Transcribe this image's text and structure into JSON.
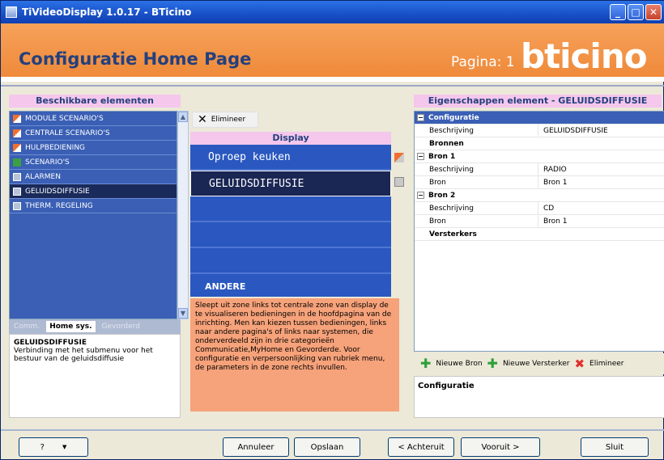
{
  "window": {
    "title": "TiVideoDisplay 1.0.17 - BTicino"
  },
  "header": {
    "title": "Configuratie Home Page",
    "pagina": "Pagina: 1",
    "logo": "bticino"
  },
  "left": {
    "heading": "Beschikbare elementen",
    "items": [
      {
        "label": "MODULE SCENARIO'S",
        "icon": "flag-icon"
      },
      {
        "label": "CENTRALE SCENARIO'S",
        "icon": "flag-icon"
      },
      {
        "label": "HULPBEDIENING",
        "icon": "flag-icon"
      },
      {
        "label": "SCENARIO'S",
        "icon": "green-icon"
      },
      {
        "label": "ALARMEN",
        "icon": "gray-icon"
      },
      {
        "label": "GELUIDSDIFFUSIE",
        "icon": "gray-icon"
      },
      {
        "label": "THERM. REGELING",
        "icon": "gray-icon"
      }
    ],
    "tabs": [
      "Comm.",
      "Home sys.",
      "Gevorderd"
    ],
    "desc_title": "GELUIDSDIFFUSIE",
    "desc_text": "Verbinding met het submenu voor het bestuur van de geluidsdiffusie"
  },
  "center": {
    "elimineer": "Elimineer",
    "display_heading": "Display",
    "rows": [
      "Oproep keuken",
      "GELUIDSDIFFUSIE",
      "",
      "",
      "",
      "ANDERE"
    ],
    "info": "Sleept uit zone links tot centrale zone van display de te visualiseren bedieningen in de hoofdpagina van de inrichting. Men kan kiezen tussen bedieningen, links naar andere pagina's of links naar systemen, die onderverdeeld zijn in drie categorieën Communicatie,MyHome en Gevorderde. Voor configuratie en verpersoonlijking van rubriek menu, de parameters in de zone rechts invullen."
  },
  "right": {
    "heading": "Eigenschappen element - GELUIDSDIFFUSIE",
    "props": [
      {
        "type": "group",
        "label": "Configuratie"
      },
      {
        "type": "row",
        "k": "Beschrijving",
        "v": "GELUIDSDIFFUSIE"
      },
      {
        "type": "bold",
        "k": "Bronnen",
        "v": ""
      },
      {
        "type": "group",
        "label": "Bron 1"
      },
      {
        "type": "row",
        "k": "Beschrijving",
        "v": "RADIO"
      },
      {
        "type": "row",
        "k": "Bron",
        "v": "Bron 1"
      },
      {
        "type": "group",
        "label": "Bron 2"
      },
      {
        "type": "row",
        "k": "Beschrijving",
        "v": "CD"
      },
      {
        "type": "row",
        "k": "Bron",
        "v": "Bron 1"
      },
      {
        "type": "bold",
        "k": "Versterkers",
        "v": ""
      }
    ],
    "btn_new_source": "Nieuwe Bron",
    "btn_new_amp": "Nieuwe Versterker",
    "btn_elim": "Elimineer",
    "config_label": "Configuratie"
  },
  "footer": {
    "help": "?",
    "annuleer": "Annuleer",
    "opslaan": "Opslaan",
    "achteruit": "< Achteruit",
    "vooruit": "Vooruit >",
    "sluit": "Sluit"
  }
}
